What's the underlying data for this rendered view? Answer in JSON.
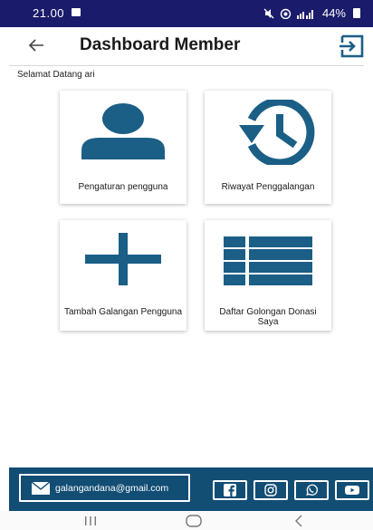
{
  "status_bar": {
    "time": "21.00",
    "icons": [
      "mute-icon",
      "wifi-icon",
      "signal-icon"
    ],
    "battery": "44%",
    "colors": {
      "background": "#1b1b6b",
      "text": "#ffffff"
    }
  },
  "app_bar": {
    "title": "Dashboard Member",
    "back_icon": "arrow-left-icon",
    "logout_icon": "logout-icon"
  },
  "greeting": "Selamat Datang ari",
  "menu": [
    {
      "label": "Pengaturan pengguna",
      "icon": "user-icon"
    },
    {
      "label": "Riwayat Penggalangan",
      "icon": "history-icon"
    },
    {
      "label": "Tambah Galangan Pengguna",
      "icon": "plus-icon"
    },
    {
      "label": "Daftar Golongan Donasi Saya",
      "icon": "list-icon"
    }
  ],
  "footer": {
    "email": "galangandana@gmail.com",
    "social": [
      "facebook-icon",
      "instagram-icon",
      "whatsapp-icon",
      "youtube-icon"
    ],
    "colors": {
      "background": "#124d74",
      "icon": "#1b5e86"
    }
  },
  "colors": {
    "accent": "#1b5e86"
  }
}
